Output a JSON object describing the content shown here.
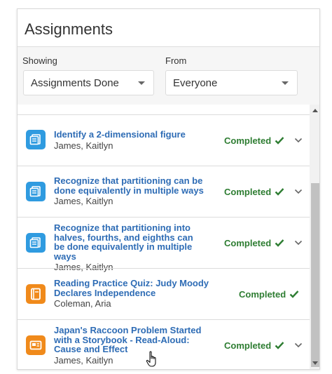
{
  "panel": {
    "title": "Assignments"
  },
  "filters": {
    "showing_label": "Showing",
    "showing_value": "Assignments Done",
    "from_label": "From",
    "from_value": "Everyone"
  },
  "colors": {
    "link_blue": "#2e6cb5",
    "completed_green": "#2e7d32",
    "icon_blue": "#2f9be0",
    "icon_orange": "#f08a1b"
  },
  "assignments": [
    {
      "title": "Identify a 2-dimensional figure",
      "students": "James, Kaitlyn",
      "status": "Completed",
      "icon": "lesson-icon",
      "expandable": true
    },
    {
      "title": "Recognize that partitioning can be done equivalently in multiple ways",
      "students": "James, Kaitlyn",
      "status": "Completed",
      "icon": "lesson-icon",
      "expandable": true
    },
    {
      "title": "Recognize that partitioning into halves, fourths, and eighths can be done equivalently in multiple ways",
      "students": "James, Kaitlyn",
      "status": "Completed",
      "icon": "lesson-icon",
      "expandable": true
    },
    {
      "title": "Reading Practice Quiz: Judy Moody Declares Independence",
      "students": "Coleman, Aria",
      "status": "Completed",
      "icon": "book-icon",
      "expandable": false
    },
    {
      "title": "Japan's Raccoon Problem Started with a Storybook - Read-Aloud: Cause and Effect",
      "students": "James, Kaitlyn",
      "status": "Completed",
      "icon": "video-icon",
      "expandable": true
    }
  ]
}
